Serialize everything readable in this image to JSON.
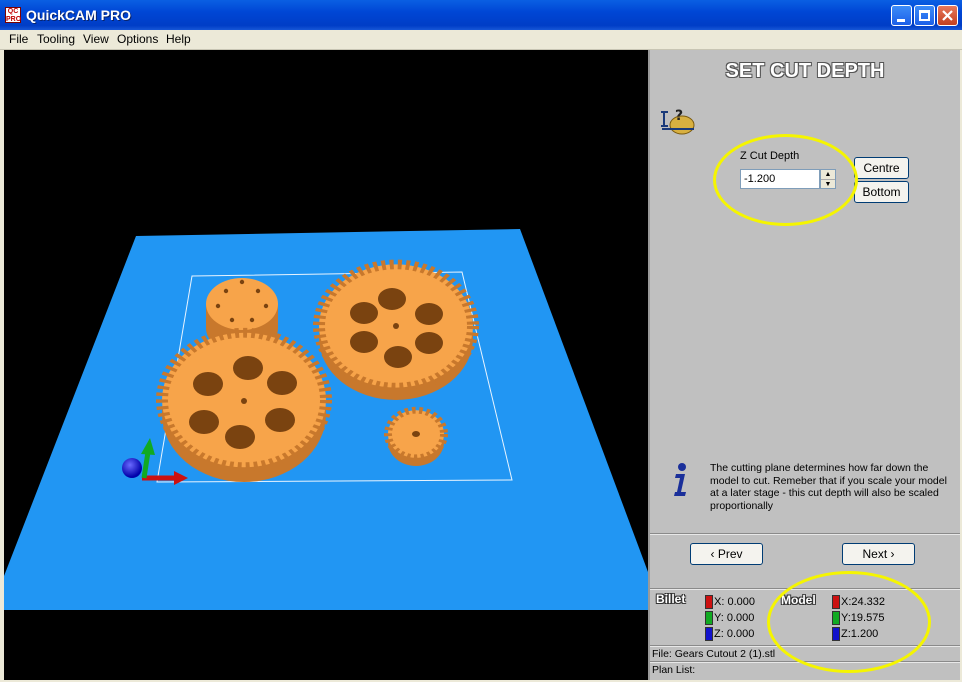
{
  "window": {
    "title": "QuickCAM PRO",
    "app_icon_text": "QC PRO"
  },
  "menu": [
    "File",
    "Tooling",
    "View",
    "Options",
    "Help"
  ],
  "panel": {
    "heading": "SET CUT DEPTH",
    "depth_label": "Z Cut Depth",
    "depth_value": "-1.200",
    "centre_label": "Centre",
    "bottom_label": "Bottom",
    "info_text": "The cutting plane determines how far down the model to cut. Remeber that if you scale your model at a later stage - this cut depth will also be scaled proportionally",
    "prev_label": "‹ Prev",
    "next_label": "Next ›"
  },
  "billet": {
    "label": "Billet",
    "x": "X: 0.000",
    "y": "Y: 0.000",
    "z": "Z: 0.000"
  },
  "model": {
    "label": "Model",
    "x": "X:24.332",
    "y": "Y:19.575",
    "z": "Z:1.200"
  },
  "status": {
    "file": "File: Gears Cutout 2 (1).stl",
    "plan_list": "Plan List:"
  },
  "colors": {
    "plane": "#2196f3",
    "gear": "#f7a44a",
    "axis_x": "#cc1111",
    "axis_y": "#11aa22",
    "axis_z": "#1111cc",
    "highlight": "#f5f500"
  },
  "icons": [
    "app-icon",
    "minimize-icon",
    "maximize-icon",
    "close-icon",
    "depth-help-icon",
    "info-icon",
    "spin-up-icon",
    "spin-down-icon"
  ]
}
